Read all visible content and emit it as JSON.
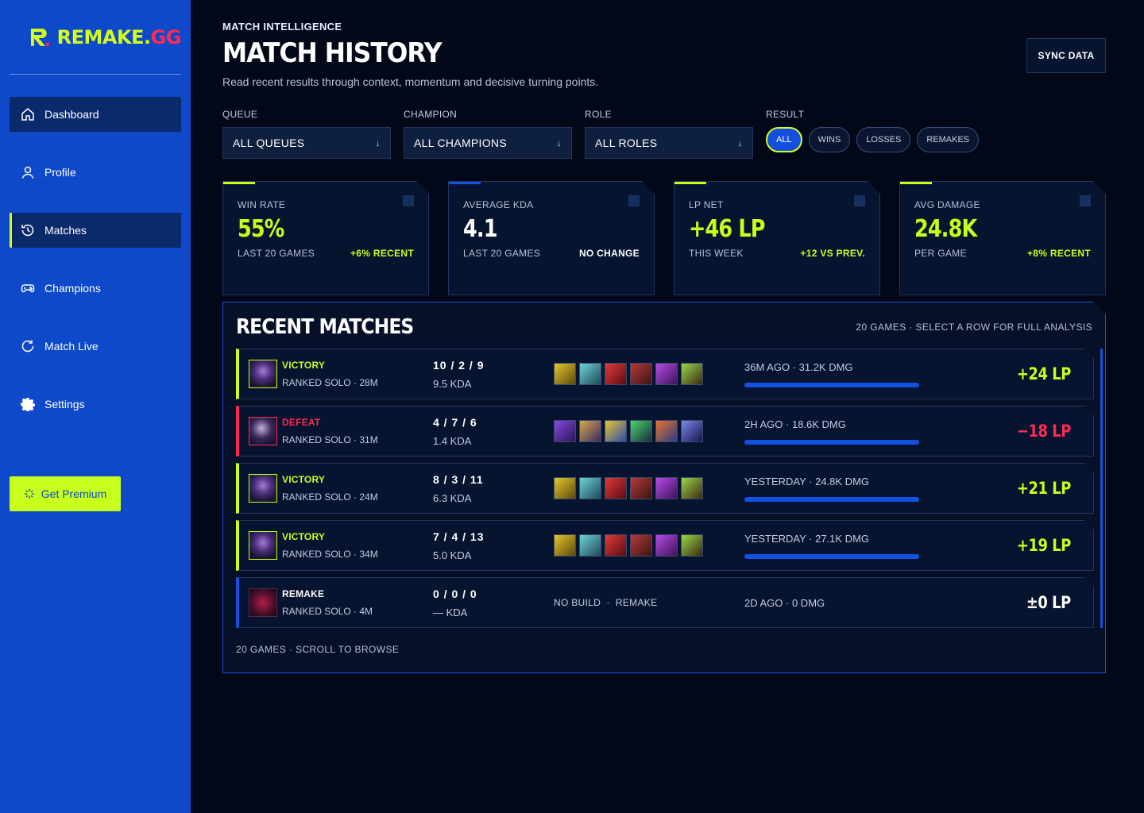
{
  "brand": {
    "part1": "REMAKE.",
    "part2": "GG",
    "accent": "#d4ff1c",
    "alt": "#ff2a55"
  },
  "sidebar": {
    "items": [
      {
        "label": "Dashboard",
        "icon": "home-icon"
      },
      {
        "label": "Profile",
        "icon": "user-icon"
      },
      {
        "label": "Matches",
        "icon": "history-icon"
      },
      {
        "label": "Champions",
        "icon": "gamepad-icon"
      },
      {
        "label": "Match Live",
        "icon": "refresh-icon"
      },
      {
        "label": "Settings",
        "icon": "gear-icon"
      }
    ],
    "premium": "Get Premium"
  },
  "header": {
    "eyebrow": "MATCH INTELLIGENCE",
    "title": "MATCH HISTORY",
    "subtitle": "Read recent results through context, momentum and decisive turning points.",
    "sync": "SYNC DATA"
  },
  "filters": {
    "queue": {
      "label": "QUEUE",
      "value": "ALL QUEUES"
    },
    "champion": {
      "label": "CHAMPION",
      "value": "ALL CHAMPIONS"
    },
    "role": {
      "label": "ROLE",
      "value": "ALL ROLES"
    },
    "result": {
      "label": "RESULT",
      "options": [
        "ALL",
        "WINS",
        "LOSSES",
        "REMAKES"
      ],
      "selected": "ALL"
    }
  },
  "stats": [
    {
      "label": "WIN RATE",
      "value": "55%",
      "sub": "LAST 20 GAMES",
      "change": "+6% RECENT"
    },
    {
      "label": "AVERAGE KDA",
      "value": "4.1",
      "sub": "LAST 20 GAMES",
      "change": "NO CHANGE"
    },
    {
      "label": "LP NET",
      "value": "+46 LP",
      "sub": "THIS WEEK",
      "change": "+12 VS PREV."
    },
    {
      "label": "AVG DAMAGE",
      "value": "24.8K",
      "sub": "PER GAME",
      "change": "+8% RECENT"
    }
  ],
  "matches": {
    "title": "RECENT MATCHES",
    "note": "20 GAMES · SELECT A ROW FOR FULL ANALYSIS",
    "footer": "20 GAMES · SCROLL TO BROWSE",
    "rows": [
      {
        "result": "VICTORY",
        "queue": "RANKED SOLO · 28M",
        "kda": "10 / 2 / 9",
        "ratio": "9.5 KDA",
        "meta": "36M AGO · 31.2K DMG",
        "lp": "+24 LP",
        "damage_fraction": 1.0
      },
      {
        "result": "DEFEAT",
        "queue": "RANKED SOLO · 31M",
        "kda": "4 / 7 / 6",
        "ratio": "1.4 KDA",
        "meta": "2H AGO · 18.6K DMG",
        "lp": "−18 LP",
        "damage_fraction": 1.0
      },
      {
        "result": "VICTORY",
        "queue": "RANKED SOLO · 24M",
        "kda": "8 / 3 / 11",
        "ratio": "6.3 KDA",
        "meta": "YESTERDAY · 24.8K DMG",
        "lp": "+21 LP",
        "damage_fraction": 1.0
      },
      {
        "result": "VICTORY",
        "queue": "RANKED SOLO · 34M",
        "kda": "7 / 4 / 13",
        "ratio": "5.0 KDA",
        "meta": "YESTERDAY · 27.1K DMG",
        "lp": "+19 LP",
        "damage_fraction": 1.0
      },
      {
        "result": "REMAKE",
        "queue": "RANKED SOLO · 4M",
        "kda": "0 / 0 / 0",
        "ratio": "— KDA",
        "build": "NO BUILD  ·  REMAKE",
        "meta": "2D AGO · 0 DMG",
        "lp": "±0 LP"
      }
    ]
  }
}
